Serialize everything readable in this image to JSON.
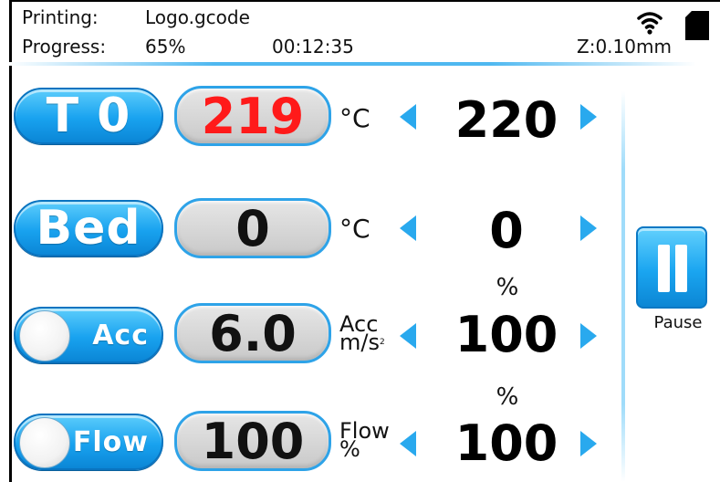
{
  "status": {
    "printing_label": "Printing:",
    "file_name": "Logo.gcode",
    "progress_label": "Progress:",
    "progress_percent": "65%",
    "elapsed_time": "00:12:35",
    "z_height": "Z:0.10mm",
    "icons": [
      "wifi-icon",
      "sd-card-icon"
    ]
  },
  "rows": {
    "tool": {
      "label": "T 0",
      "current": "219",
      "unit": "°C",
      "target": "220"
    },
    "bed": {
      "label": "Bed",
      "current": "0",
      "unit": "°C",
      "target": "0"
    },
    "acc": {
      "label": "Acc",
      "current": "6.0",
      "unit_line1": "Acc",
      "unit_line2": "m/s",
      "unit_sup": "2",
      "target_unit": "%",
      "target": "100",
      "toggle_on": false
    },
    "flow": {
      "label": "Flow",
      "current": "100",
      "unit_line1": "Flow",
      "unit_line2": "%",
      "target_unit": "%",
      "target": "100",
      "toggle_on": false
    }
  },
  "pause": {
    "label": "Pause",
    "icon": "pause-icon"
  },
  "colors": {
    "accent": "#18a2ef",
    "hot_value": "#ff1a1a",
    "arrow": "#29a9ee"
  }
}
